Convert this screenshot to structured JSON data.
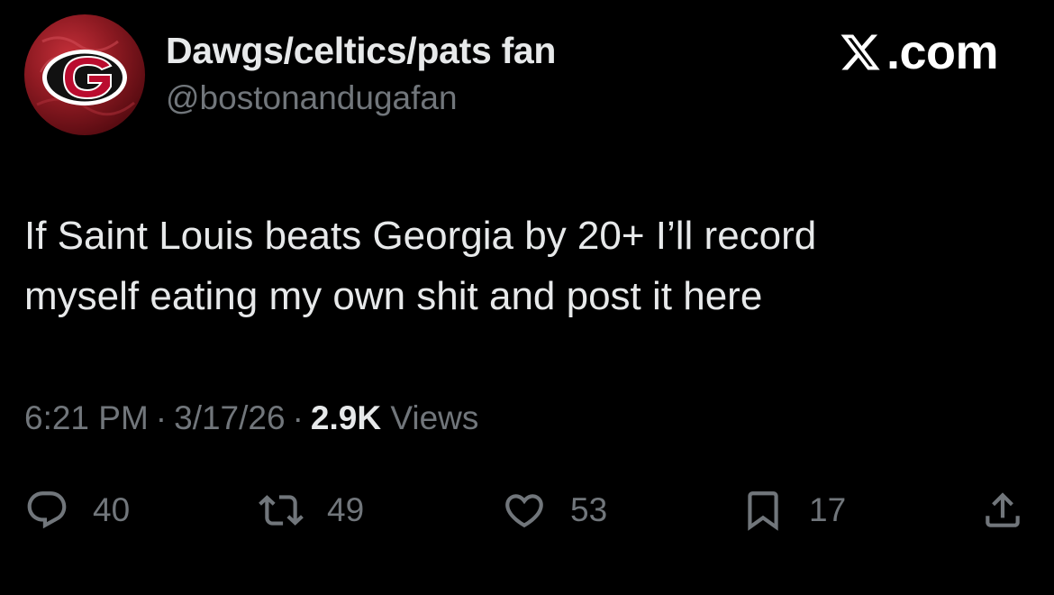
{
  "author": {
    "display_name": "Dawgs/celtics/pats fan",
    "handle": "@bostonandugafan",
    "avatar_icon": "georgia-g-logo-icon"
  },
  "brand": {
    "text": ".com",
    "icon": "x-logo-icon"
  },
  "tweet": {
    "text": "If Saint Louis beats Georgia by 20+ I’ll record\nmyself eating my own shit and post it here"
  },
  "meta": {
    "time": "6:21 PM",
    "date": "3/17/26",
    "separator": "·",
    "views_count": "2.9K",
    "views_label": "Views"
  },
  "actions": {
    "replies": {
      "icon": "reply-icon",
      "count": "40"
    },
    "reposts": {
      "icon": "repost-icon",
      "count": "49"
    },
    "likes": {
      "icon": "heart-icon",
      "count": "53"
    },
    "bookmarks": {
      "icon": "bookmark-icon",
      "count": "17"
    },
    "share": {
      "icon": "share-icon"
    }
  },
  "colors": {
    "background": "#000000",
    "primary_text": "#e7e9ea",
    "secondary_text": "#71767b",
    "avatar_red": "#8e1a22"
  }
}
